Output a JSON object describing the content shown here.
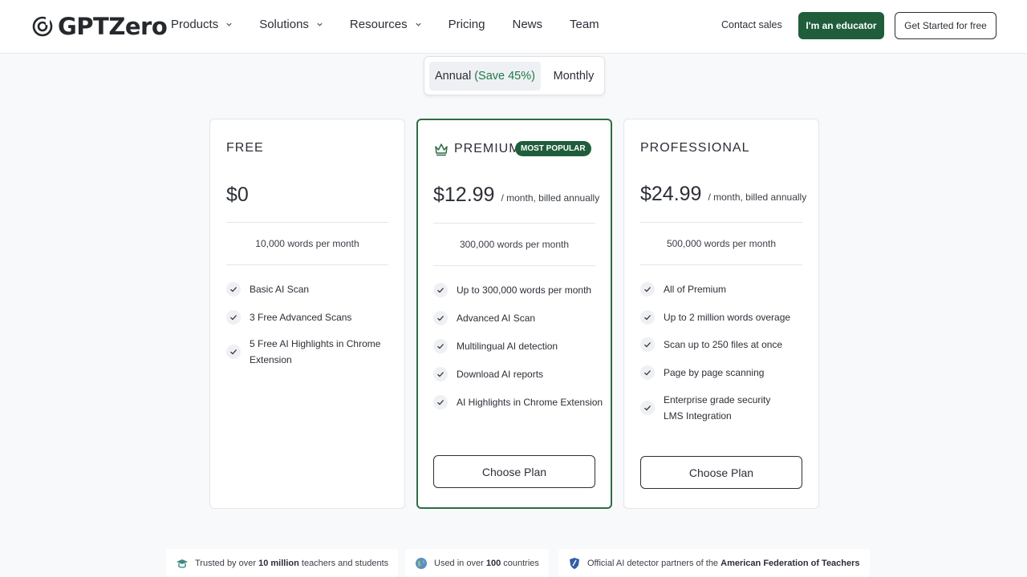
{
  "brand": {
    "name": "GPTZero"
  },
  "nav": [
    {
      "label": "Products",
      "has_menu": true
    },
    {
      "label": "Solutions",
      "has_menu": true
    },
    {
      "label": "Resources",
      "has_menu": true
    },
    {
      "label": "Pricing",
      "has_menu": false
    },
    {
      "label": "News",
      "has_menu": false
    },
    {
      "label": "Team",
      "has_menu": false
    }
  ],
  "header_actions": {
    "contact": "Contact sales",
    "educator": "I'm an educator",
    "get_started": "Get Started for free"
  },
  "billing_toggle": {
    "annual_label": "Annual",
    "annual_save": "(Save 45%)",
    "monthly_label": "Monthly",
    "selected": "annual"
  },
  "plans": [
    {
      "name": "FREE",
      "price": "$0",
      "period": "",
      "words": "10,000 words per month",
      "features": [
        "Basic AI Scan",
        "3 Free Advanced Scans",
        "5 Free AI Highlights in Chrome Extension"
      ],
      "cta": ""
    },
    {
      "name": "PREMIUM",
      "badge": "MOST POPULAR",
      "price": "$12.99",
      "period": "/ month, billed annually",
      "words": "300,000 words per month",
      "features": [
        "Up to 300,000 words per month",
        "Advanced AI Scan",
        "Multilingual AI detection",
        "Download AI reports",
        "AI Highlights in Chrome Extension"
      ],
      "cta": "Choose Plan"
    },
    {
      "name": "PROFESSIONAL",
      "price": "$24.99",
      "period": "/ month, billed annually",
      "words": "500,000 words per month",
      "features": [
        "All of Premium",
        "Up to 2 million words overage",
        "Scan up to 250 files at once",
        "Page by page scanning",
        "Enterprise grade security LMS Integration"
      ],
      "cta": "Choose Plan"
    }
  ],
  "trust": [
    {
      "pre": "Trusted by over",
      "bold": "10 million",
      "post": "teachers and students",
      "icon": "graduation-cap-icon"
    },
    {
      "pre": "Used in over",
      "bold": "100",
      "post": "countries",
      "icon": "globe-icon"
    },
    {
      "pre": "Official AI detector partners of the",
      "bold": "American Federation of Teachers",
      "post": "",
      "icon": "shield-icon"
    }
  ],
  "colors": {
    "brand_green": "#1f5d3b",
    "popular_border": "#2f6b45",
    "save_green": "#1f7a48"
  }
}
